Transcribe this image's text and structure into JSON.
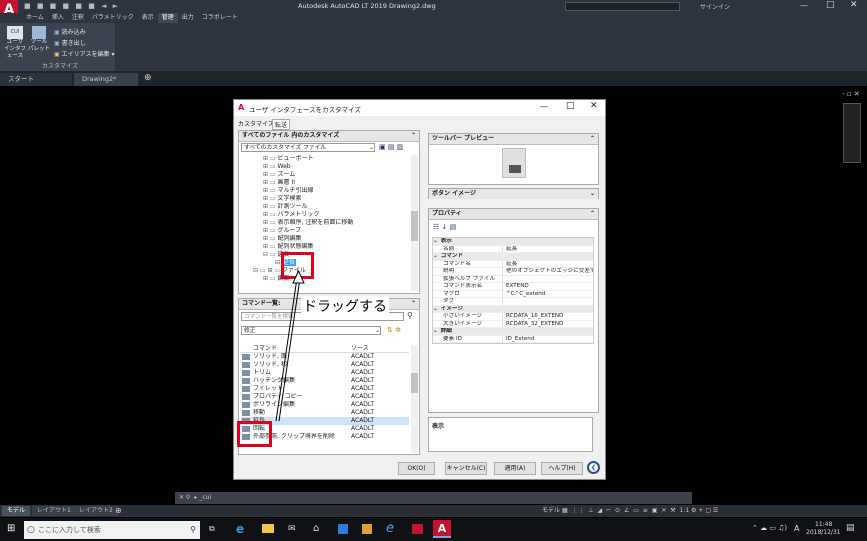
{
  "app": {
    "title": "Autodesk AutoCAD LT 2019   Drawing2.dwg",
    "logo_letter": "A",
    "user": "サインイン"
  },
  "menu": [
    "ホーム",
    "挿入",
    "注釈",
    "パラメトリック",
    "表示",
    "管理",
    "出力",
    "コラボレート"
  ],
  "menu_active_index": 5,
  "ribbon": {
    "big_buttons": [
      {
        "label": "ユーザ インタフェース"
      },
      {
        "label": "ツール パレット"
      }
    ],
    "small_buttons": [
      "読み込み",
      "書き出し",
      "エイリアスを編集"
    ],
    "panel_label": "カスタマイズ"
  },
  "doc_tabs": [
    "スタート",
    "Drawing2*"
  ],
  "layout_tabs": [
    "モデル",
    "レイアウト1",
    "レイアウト2"
  ],
  "command_line": "_cui",
  "status": {
    "model": "モデル",
    "scale": "1:1"
  },
  "taskbar": {
    "search_placeholder": "ここに入力して検索",
    "time": "11:48",
    "date": "2018/12/31",
    "ime": "A"
  },
  "dialog": {
    "title": "ユーザ インタフェースをカスタマイズ",
    "tabs": [
      "カスタマイズ",
      "転送"
    ],
    "left_top": {
      "header": "すべてのファイル 内のカスタマイズ",
      "dropdown": "すべてのカスタマイズ ファイル",
      "tree": [
        "ビューポート",
        "Web",
        "ズーム",
        "画層 II",
        "マルチ引出線",
        "文字検索",
        "計測ツール",
        "パラメトリック",
        "表示順序, 注釈を前面に移動",
        "グループ",
        "配列編集",
        "配列状態編集",
        "延長"
      ],
      "selected_item": "延長",
      "file_node": "ファイル",
      "edit_node": "編集"
    },
    "left_bottom": {
      "header": "コマンド一覧:",
      "search_placeholder": "コマンド一覧を検索",
      "filter": "修正",
      "col_command": "コマンド",
      "col_source": "ソース",
      "commands": [
        {
          "name": "ソリッド, 面",
          "src": "ACADLT"
        },
        {
          "name": "ソリッド, 和",
          "src": "ACADLT"
        },
        {
          "name": "トリム",
          "src": "ACADLT"
        },
        {
          "name": "ハッチング編集",
          "src": "ACADLT"
        },
        {
          "name": "フィレット",
          "src": "ACADLT"
        },
        {
          "name": "プロパティ コピー",
          "src": "ACADLT"
        },
        {
          "name": "ポリライン編集",
          "src": "ACADLT"
        },
        {
          "name": "移動",
          "src": "ACADLT"
        },
        {
          "name": "延長",
          "src": "ACADLT"
        },
        {
          "name": "回転",
          "src": "ACADLT"
        },
        {
          "name": "外部参照, クリップ境界を削除",
          "src": "ACADLT"
        }
      ]
    },
    "right": {
      "toolbar_preview": "ツールバー プレビュー",
      "button_image": "ボタン イメージ",
      "properties": "プロパティ",
      "description": "表示",
      "props": [
        {
          "cat": "表示"
        },
        {
          "k": "名前",
          "v": "延長"
        },
        {
          "cat": "コマンド"
        },
        {
          "k": "コマンド名",
          "v": "延長"
        },
        {
          "k": "説明",
          "v": "他のオブジェクトのエッジに交差する"
        },
        {
          "k": "拡張ヘルプ ファイル",
          "v": ""
        },
        {
          "k": "コマンド表示名",
          "v": "EXTEND"
        },
        {
          "k": "マクロ",
          "v": "^C^C_extend"
        },
        {
          "k": "タグ",
          "v": ""
        },
        {
          "cat": "イメージ"
        },
        {
          "k": "小さいイメージ",
          "v": "RCDATA_16_EXTEND"
        },
        {
          "k": "大きいイメージ",
          "v": "RCDATA_32_EXTEND"
        },
        {
          "cat": "詳細"
        },
        {
          "k": "要素 ID",
          "v": "ID_Extend"
        }
      ]
    },
    "buttons": {
      "ok": "OK(O)",
      "cancel": "キャンセル(C)",
      "apply": "適用(A)",
      "help": "ヘルプ(H)"
    }
  },
  "annotation": {
    "text": "ドラッグする",
    "color": "#e3001b"
  }
}
